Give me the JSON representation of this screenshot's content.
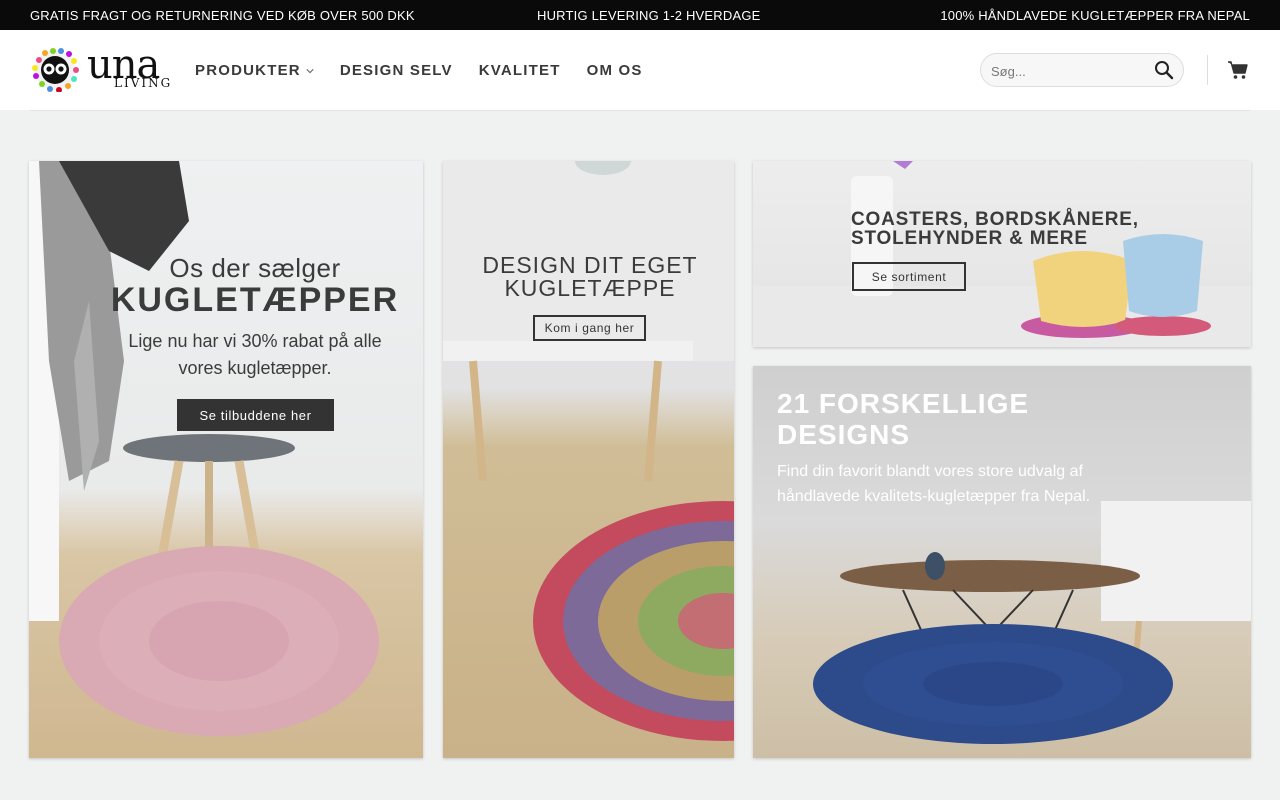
{
  "topbar": {
    "left": "GRATIS FRAGT OG RETURNERING VED KØB OVER 500 DKK",
    "center": "HURTIG LEVERING 1-2 HVERDAGE",
    "right": "100% HÅNDLAVEDE KUGLETÆPPER FRA NEPAL"
  },
  "logo": {
    "word": "una",
    "sub": "LIVING"
  },
  "nav": [
    {
      "label": "PRODUKTER",
      "icon": "chevron-down-icon"
    },
    {
      "label": "DESIGN SELV"
    },
    {
      "label": "KVALITET"
    },
    {
      "label": "OM OS"
    }
  ],
  "search": {
    "placeholder": "Søg...",
    "icon": "search-icon"
  },
  "cart": {
    "icon": "cart-icon"
  },
  "panels": {
    "sale": {
      "line1": "Os der sælger",
      "line2": "KUGLETÆPPER",
      "text": "Lige nu har vi 30% rabat på alle vores kugletæpper.",
      "button": "Se tilbuddene her"
    },
    "design": {
      "title": "DESIGN DIT EGET KUGLETÆPPE",
      "button": "Kom i gang her"
    },
    "coasters": {
      "title": "COASTERS, BORDSKÅNERE, STOLEHYNDER & MERE",
      "button": "Se sortiment"
    },
    "designs": {
      "title": "21 FORSKELLIGE DESIGNS",
      "text": "Find din favorit blandt vores store udvalg af håndlavede kvalitets-kugletæpper fra Nepal."
    }
  },
  "colors": {
    "topbar": "#0a0a0a",
    "button": "#333333",
    "background": "#f0f1f1"
  }
}
